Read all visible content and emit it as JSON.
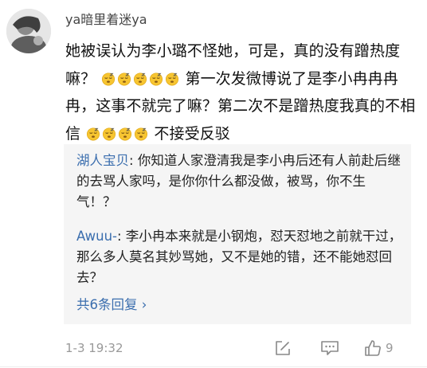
{
  "comment": {
    "username": "ya暗里着迷ya",
    "text_part1": "她被误认为李小璐不怪她，可是，真的没有蹭热度嘛？",
    "text_part2": "第一次发微博说了是李小冉冉冉冉，这事不就完了嘛？第二次不是蹭热度我真的不相信",
    "text_part3": "不接受反驳",
    "emoji_name": "sleepy-face-emoji",
    "timestamp": "1-3 19:32",
    "like_count": "9"
  },
  "replies": [
    {
      "name": "湖人宝贝",
      "sep": ": ",
      "text": "你知道人家澄清我是李小冉后还有人前赴后继的去骂人家吗，是你你什么都没做，被骂，你不生气！？"
    },
    {
      "name": "Awuu-",
      "sep": ": ",
      "text": "李小冉本来就是小钢炮，怼天怼地之前就干过，那么多人莫名其妙骂她，又不是她的错，还不能她怼回去？"
    }
  ],
  "more_replies": "共6条回复 ›",
  "icons": {
    "share": "share-edit-icon",
    "comment": "comment-icon",
    "like": "thumbs-up-icon"
  },
  "colors": {
    "link": "#3b6eae",
    "muted": "#999999",
    "reply_bg": "#f5f5f5"
  }
}
